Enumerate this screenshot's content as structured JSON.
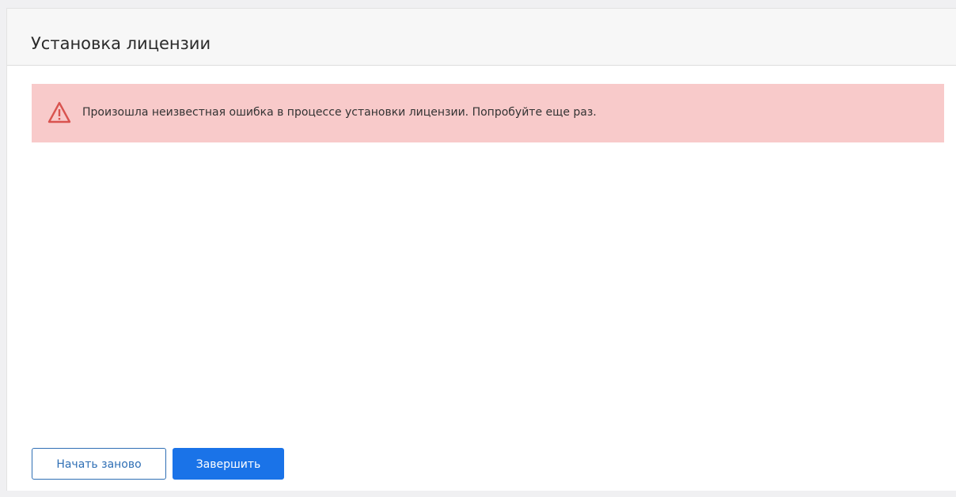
{
  "header": {
    "title": "Установка лицензии"
  },
  "alert": {
    "message": "Произошла неизвестная ошибка в процессе установки лицензии. Попробуйте еще раз.",
    "icon": "warning-triangle-icon",
    "background_color": "#f8caca",
    "icon_color": "#d9534f"
  },
  "actions": {
    "restart_label": "Начать заново",
    "finish_label": "Завершить",
    "primary_color": "#1a73e8"
  }
}
